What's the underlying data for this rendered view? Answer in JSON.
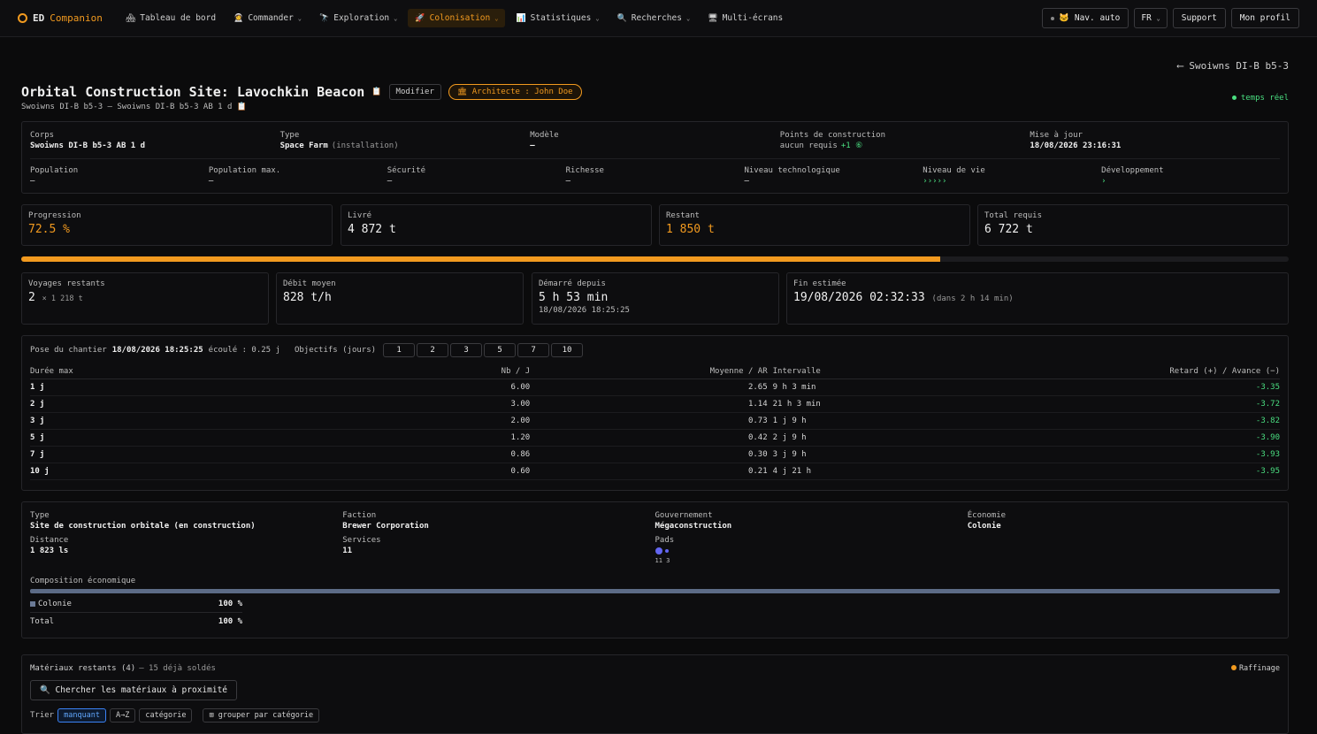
{
  "brand": {
    "ed": "ED",
    "companion": "Companion"
  },
  "nav": {
    "items": [
      {
        "icon": "🏘",
        "label": "Tableau de bord",
        "chevron": false
      },
      {
        "icon": "👩‍🚀",
        "label": "Commander",
        "chevron": true
      },
      {
        "icon": "🔭",
        "label": "Exploration",
        "chevron": true
      },
      {
        "icon": "🚀",
        "label": "Colonisation",
        "chevron": true,
        "active": true
      },
      {
        "icon": "📊",
        "label": "Statistiques",
        "chevron": true
      },
      {
        "icon": "🔍",
        "label": "Recherches",
        "chevron": true
      },
      {
        "icon": "🖥",
        "label": "Multi-écrans",
        "chevron": false
      }
    ],
    "auto_icon": "🐱",
    "auto_label": "Nav. auto",
    "lang": "FR",
    "support": "Support",
    "profile": "Mon profil"
  },
  "header": {
    "back_link": "⟵ Swoiwns DI-B b5-3",
    "title": "Orbital Construction Site: Lavochkin Beacon",
    "copy_icon": "📋",
    "edit_label": "Modifier",
    "architect_label": "🏛 Architecte : John Doe",
    "subtitle": "Swoiwns DI-B b5-3 — Swoiwns DI-B b5-3 AB 1 d 📋",
    "live_label": "temps réel"
  },
  "info": {
    "row1": [
      {
        "label": "Corps",
        "value": "Swoiwns DI-B b5-3 AB 1 d",
        "extra": ""
      },
      {
        "label": "Type",
        "value": "Space Farm",
        "extra": "(installation)"
      },
      {
        "label": "Modèle",
        "value": "—",
        "extra": ""
      },
      {
        "label": "Points de construction",
        "value": "aucun requis",
        "extra": "+1 ⑥"
      },
      {
        "label": "Mise à jour",
        "value": "18/08/2026 23:16:31",
        "extra": ""
      }
    ],
    "row2": [
      {
        "label": "Population",
        "value": "—"
      },
      {
        "label": "Population max.",
        "value": "—"
      },
      {
        "label": "Sécurité",
        "value": "—"
      },
      {
        "label": "Richesse",
        "value": "—"
      },
      {
        "label": "Niveau technologique",
        "value": "—"
      },
      {
        "label": "Niveau de vie",
        "value": "›››››"
      },
      {
        "label": "Développement",
        "value": "›"
      }
    ]
  },
  "stats": [
    {
      "label": "Progression",
      "value": "72.5 %",
      "color": "#f29a1f"
    },
    {
      "label": "Livré",
      "value": "4 872 t",
      "color": "#f0f0f0"
    },
    {
      "label": "Restant",
      "value": "1 850 t",
      "color": "#f29a1f"
    },
    {
      "label": "Total requis",
      "value": "6 722 t",
      "color": "#f0f0f0"
    }
  ],
  "progress": {
    "fraction": 0.725
  },
  "metrics": {
    "voyages_label": "Voyages restants",
    "voyages_value": "2",
    "voyages_extra": "× 1 218 t",
    "debit_label": "Débit moyen",
    "debit_value": "828 t/h",
    "started_label": "Démarré depuis",
    "started_value": "5 h 53 min",
    "started_date": "18/08/2026 18:25:25",
    "end_label": "Fin estimée",
    "end_value": "19/08/2026 02:32:33",
    "end_extra": "(dans 2 h 14 min)"
  },
  "schedule": {
    "pose_label": "Pose du chantier",
    "pose_date": "18/08/2026 18:25:25",
    "elapsed": "écoulé : 0.25 j",
    "objectives_label": "Objectifs (jours)",
    "objectives": [
      "1",
      "2",
      "3",
      "5",
      "7",
      "10"
    ],
    "headers": [
      "Durée max",
      "Nb / J",
      "Moyenne / AR",
      "Intervalle",
      "Retard (+) / Avance (−)"
    ],
    "rows": [
      [
        "1 j",
        "6.00",
        "2.65",
        "9 h 3 min",
        "-3.35"
      ],
      [
        "2 j",
        "3.00",
        "1.14",
        "21 h 3 min",
        "-3.72"
      ],
      [
        "3 j",
        "2.00",
        "0.73",
        "1 j 9 h",
        "-3.82"
      ],
      [
        "5 j",
        "1.20",
        "0.42",
        "2 j 9 h",
        "-3.90"
      ],
      [
        "7 j",
        "0.86",
        "0.30",
        "3 j 9 h",
        "-3.93"
      ],
      [
        "10 j",
        "0.60",
        "0.21",
        "4 j 21 h",
        "-3.95"
      ]
    ]
  },
  "station": {
    "fields": [
      {
        "label": "Type",
        "value": "Site de construction orbitale (en construction)"
      },
      {
        "label": "Faction",
        "value": "Brewer Corporation"
      },
      {
        "label": "Gouvernement",
        "value": "Mégaconstruction"
      },
      {
        "label": "Économie",
        "value": "Colonie"
      },
      {
        "label": "Distance",
        "value": "1 823 ls"
      },
      {
        "label": "Services",
        "value": "11"
      },
      {
        "label": "Pads",
        "value": "11 3"
      }
    ],
    "composition_label": "Composition économique",
    "composition": [
      {
        "name": "Colonie",
        "pct": "100 %"
      }
    ],
    "total_label": "Total",
    "total_pct": "100 %"
  },
  "materials": {
    "title": "Matériaux restants (4)",
    "solded": "— 15 déjà soldés",
    "refining": "Raffinage",
    "search_label": "🔍 Chercher les matériaux à proximité",
    "sort_label": "Trier",
    "sort_options": [
      "manquant",
      "A→Z",
      "catégorie"
    ],
    "group_label": "⊞ grouper par catégorie"
  }
}
